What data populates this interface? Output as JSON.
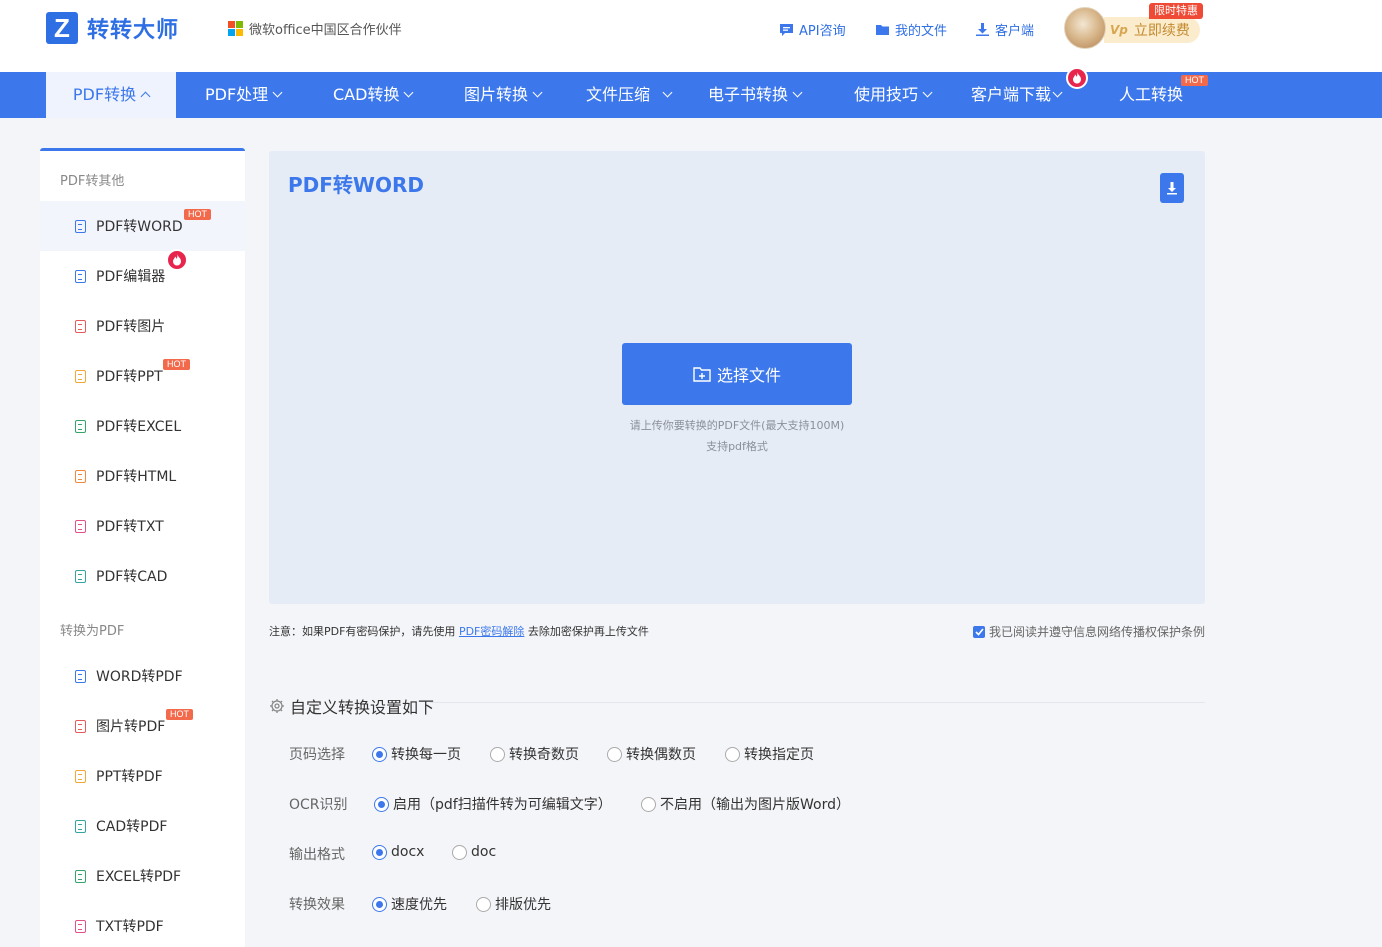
{
  "header": {
    "logo_mark": "Z",
    "logo_text": "转转大师",
    "partner": "微软office中国区合作伙伴",
    "links": [
      {
        "label": "API咨询",
        "icon": "chat-icon"
      },
      {
        "label": "我的文件",
        "icon": "folder-icon"
      },
      {
        "label": "客户端",
        "icon": "download-icon"
      }
    ],
    "vip_badge": "Vp",
    "renew_label": "立即续费",
    "promo_badge": "限时特惠"
  },
  "nav": {
    "items": [
      {
        "label": "PDF转换"
      },
      {
        "label": "PDF处理"
      },
      {
        "label": "CAD转换"
      },
      {
        "label": "图片转换"
      },
      {
        "label": "文件压缩"
      },
      {
        "label": "电子书转换"
      },
      {
        "label": "使用技巧"
      },
      {
        "label": "客户端下载"
      },
      {
        "label": "人工转换"
      }
    ],
    "hot_badge": "HOT"
  },
  "sidebar": {
    "group1": "PDF转其他",
    "group1_items": [
      {
        "label": "PDF转WORD",
        "icon_color": "#3c78ec"
      },
      {
        "label": "PDF编辑器",
        "icon_color": "#3c78ec"
      },
      {
        "label": "PDF转图片",
        "icon_color": "#e55a5a"
      },
      {
        "label": "PDF转PPT",
        "icon_color": "#f0a838"
      },
      {
        "label": "PDF转EXCEL",
        "icon_color": "#35a36a"
      },
      {
        "label": "PDF转HTML",
        "icon_color": "#f08a3a"
      },
      {
        "label": "PDF转TXT",
        "icon_color": "#e0508a"
      },
      {
        "label": "PDF转CAD",
        "icon_color": "#35a3a0"
      }
    ],
    "group2": "转换为PDF",
    "group2_items": [
      {
        "label": "WORD转PDF",
        "icon_color": "#3c78ec"
      },
      {
        "label": "图片转PDF",
        "icon_color": "#e55a5a"
      },
      {
        "label": "PPT转PDF",
        "icon_color": "#f0a838"
      },
      {
        "label": "CAD转PDF",
        "icon_color": "#35a3a0"
      },
      {
        "label": "EXCEL转PDF",
        "icon_color": "#35a36a"
      },
      {
        "label": "TXT转PDF",
        "icon_color": "#e0508a"
      }
    ],
    "hot_badge": "HOT"
  },
  "main": {
    "title": "PDF转WORD",
    "choose_button": "选择文件",
    "hint_line1": "请上传你要转换的PDF文件(最大支持100M)",
    "hint_line2": "支持pdf格式"
  },
  "notice": {
    "prefix": "注意：如果PDF有密码保护，请先使用",
    "link": "PDF密码解除",
    "suffix": "去除加密保护再上传文件",
    "agree": "我已阅读并遵守信息网络传播权保护条例"
  },
  "settings": {
    "title": "自定义转换设置如下",
    "rows": [
      {
        "label": "页码选择",
        "options": [
          "转换每一页",
          "转换奇数页",
          "转换偶数页",
          "转换指定页"
        ],
        "selected": "转换每一页"
      },
      {
        "label": "OCR识别",
        "options": [
          "启用（pdf扫描件转为可编辑文字）",
          "不启用（输出为图片版Word）"
        ],
        "selected": "启用（pdf扫描件转为可编辑文字）"
      },
      {
        "label": "输出格式",
        "options": [
          "docx",
          "doc"
        ],
        "selected": "docx"
      },
      {
        "label": "转换效果",
        "options": [
          "速度优先",
          "排版优先"
        ],
        "selected": "速度优先"
      }
    ]
  },
  "colors": {
    "accent": "#3c78ec",
    "hot": "#f3694b",
    "fire": "#e8264d"
  }
}
